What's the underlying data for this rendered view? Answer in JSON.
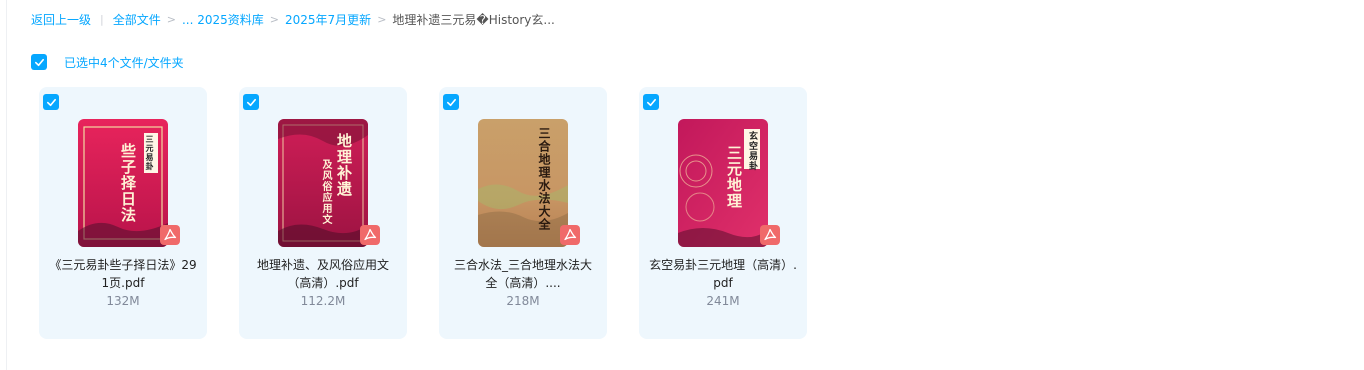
{
  "breadcrumb": {
    "back": "返回上一级",
    "all_files": "全部文件",
    "sep": ">",
    "ellipsis_library": "... 2025资料库",
    "month": "2025年7月更新",
    "current": "地理补遗三元易�History玄..."
  },
  "selection": {
    "label": "已选中4个文件/文件夹"
  },
  "files": [
    {
      "name": "《三元易卦些子择日法》291页.pdf",
      "size": "132M",
      "cover_title": "些子择日法",
      "cover_sub": "三元易卦"
    },
    {
      "name": "地理补遗、及风俗应用文（高清）.pdf",
      "size": "112.2M",
      "cover_title": "地理补遗",
      "cover_sub": "及风俗应用文"
    },
    {
      "name": "三合水法_三合地理水法大全（高清）....",
      "size": "218M",
      "cover_title": "三合地理水法大全"
    },
    {
      "name": "玄空易卦三元地理（高清）.pdf",
      "size": "241M",
      "cover_title": "三元地理",
      "cover_sub": "玄空易卦"
    }
  ],
  "colors": {
    "accent": "#06a7ff",
    "pdf_badge": "#f06a6a",
    "card_bg": "#eef7fd"
  },
  "icons": {
    "checkbox": "check-icon",
    "pdf": "pdf-icon"
  }
}
